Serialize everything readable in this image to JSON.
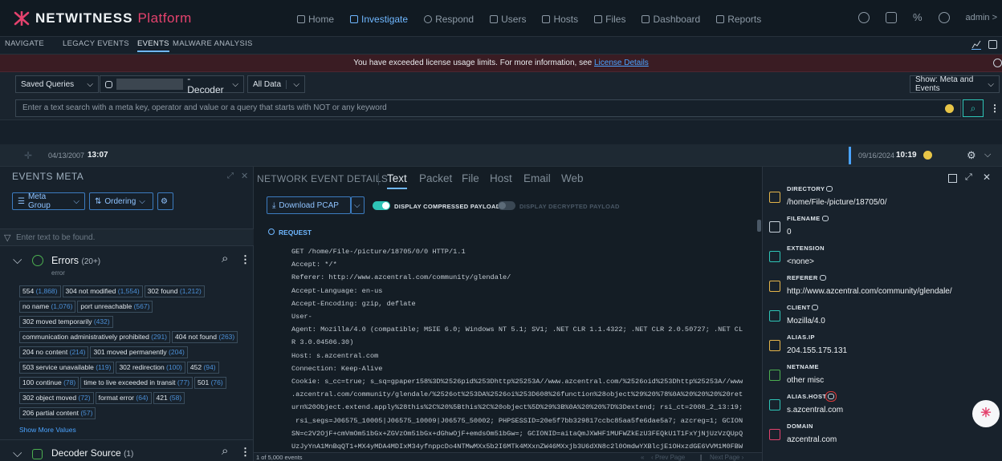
{
  "brand": {
    "part1": "NETWITNESS",
    "part2": "Platform",
    "accent": "#e4426d"
  },
  "mainmenu": [
    "Home",
    "Investigate",
    "Respond",
    "Users",
    "Hosts",
    "Files",
    "Dashboard",
    "Reports"
  ],
  "user": "admin",
  "subnav": {
    "navigate": "NAVIGATE",
    "legacy": "LEGACY EVENTS",
    "events": "EVENTS",
    "malware": "MALWARE ANALYSIS"
  },
  "banner": {
    "text": "You have exceeded license usage limits. For more information, see ",
    "link": "License Details"
  },
  "query": {
    "saved": "Saved Queries",
    "service": "- Decoder",
    "data": "All Data",
    "show": "Show: Meta and Events"
  },
  "search": {
    "placeholder": "Enter a text search with a meta key, operator and value or a query that starts with NOT or any keyword"
  },
  "timeline": {
    "start_date": "04/13/2007",
    "start_time": "13:07",
    "end_date": "09/16/2024",
    "end_time": "10:19"
  },
  "left": {
    "title": "EVENTS META",
    "meta_group": "Meta Group",
    "ordering": "Ordering",
    "filter_placeholder": "Enter text to be found.",
    "errors": {
      "title": "Errors",
      "count": "(20+)",
      "sub": "error"
    },
    "tags": [
      {
        "t": "554",
        "c": "(1,868)"
      },
      {
        "t": "304 not modified",
        "c": "(1,554)"
      },
      {
        "t": "302 found",
        "c": "(1,212)"
      },
      {
        "t": "no name",
        "c": "(1,076)"
      },
      {
        "t": "port unreachable",
        "c": "(567)"
      },
      {
        "t": "302 moved temporarily",
        "c": "(432)"
      },
      {
        "t": "communication administratively prohibited",
        "c": "(291)"
      },
      {
        "t": "404 not found",
        "c": "(263)"
      },
      {
        "t": "204 no content",
        "c": "(214)"
      },
      {
        "t": "301 moved permanently",
        "c": "(204)"
      },
      {
        "t": "503 service unavailable",
        "c": "(119)"
      },
      {
        "t": "302 redirection",
        "c": "(100)"
      },
      {
        "t": "452",
        "c": "(94)"
      },
      {
        "t": "100 continue",
        "c": "(78)"
      },
      {
        "t": "time to live exceeded in transit",
        "c": "(77)"
      },
      {
        "t": "501",
        "c": "(76)"
      },
      {
        "t": "302 object moved",
        "c": "(72)"
      },
      {
        "t": "format error",
        "c": "(64)"
      },
      {
        "t": "421",
        "c": "(58)"
      },
      {
        "t": "206 partial content",
        "c": "(57)"
      }
    ],
    "show_more": "Show More Values",
    "decoder": {
      "title": "Decoder Source",
      "count": "(1)"
    }
  },
  "center": {
    "title": "NETWORK EVENT DETAILS",
    "tabs": [
      "Text",
      "Packet",
      "File",
      "Host",
      "Email",
      "Web"
    ],
    "download": "Download PCAP",
    "compressed": "DISPLAY COMPRESSED PAYLOADS",
    "decrypted": "DISPLAY DECRYPTED PAYLOAD",
    "request": "REQUEST",
    "code": "GET /home/File-/picture/18705/0/0 HTTP/1.1\nAccept: */*\nReferer: http://www.azcentral.com/community/glendale/\nAccept-Language: en-us\nAccept-Encoding: gzip, deflate\nUser-\nAgent: Mozilla/4.0 (compatible; MSIE 6.0; Windows NT 5.1; SV1; .NET CLR 1.1.4322; .NET CLR 2.0.50727; .NET CL\nR 3.0.04506.30)\nHost: s.azcentral.com\nConnection: Keep-Alive\nCookie: s_cc=true; s_sq=gpaper158%3D%2526pid%253Dhttp%25253A//www.azcentral.com/%2526oid%253Dhttp%25253A//www\n.azcentral.com/community/glendale/%2526ot%253DA%2526oi%253D608%26function%28object%29%20%78%0A%20%20%20%20ret\nurn%20Object.extend.apply%28this%2C%20%5Bthis%2C%20object%5D%29%3B%0A%20%20%7D%3Dextend; rsi_ct=2008_2_13:19;\n rsi_segs=J06575_10005|J06575_10009|J06575_50002; PHPSESSID=20e5f7bb329817ccbc85aa5fe6dae5a7; azcreg=1; GCION\nSN=c2V2OjF+cmVmOm51bGx+ZGVzOm51bGx+dGhwOjF+emdsOm51bGw=; GCIONID=aitaQmJXWHF1MUFWZkEzU3FEQkU1T1FxYjNjUzVzQUpQ\nUzJyYnA1MnBqQT1+MX4yMDA4MDIxM34yfnppcDo4NTMwMXx5b2I6MTk4MXxnZW46MXxjb3U6dXN8c2l0OmdwYXBlcjE1OHxzdGE6VVM1M0FBW",
    "footer_count": "1 of 5,000 events",
    "prev": "Prev Page",
    "next": "Next Page"
  },
  "meta_items": [
    {
      "key": "DIRECTORY",
      "val": "/home/File-/picture/18705/0/",
      "bino": true
    },
    {
      "key": "FILENAME",
      "val": "0",
      "bino": true
    },
    {
      "key": "EXTENSION",
      "val": "<none>",
      "bino": false
    },
    {
      "key": "REFERER",
      "val": "http://www.azcentral.com/community/glendale/",
      "bino": true
    },
    {
      "key": "CLIENT",
      "val": "Mozilla/4.0",
      "bino": true
    },
    {
      "key": "ALIAS.IP",
      "val": "204.155.175.131",
      "bino": false
    },
    {
      "key": "NETNAME",
      "val": "other misc",
      "bino": false
    },
    {
      "key": "ALIAS.HOST",
      "val": "s.azcentral.com",
      "bino": true
    },
    {
      "key": "DOMAIN",
      "val": "azcentral.com",
      "bino": false
    }
  ]
}
